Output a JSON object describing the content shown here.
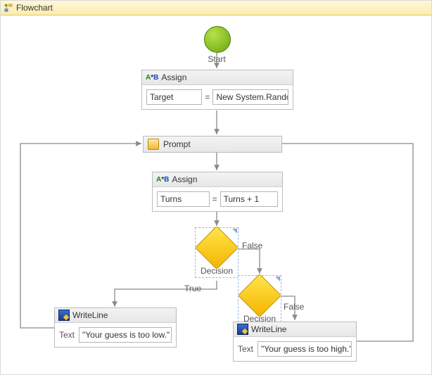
{
  "header": {
    "title": "Flowchart"
  },
  "start": {
    "label": "Start"
  },
  "assign1": {
    "title": "Assign",
    "left": "Target",
    "op": "=",
    "right": "New System.Rando"
  },
  "prompt": {
    "title": "Prompt"
  },
  "assign2": {
    "title": "Assign",
    "left": "Turns",
    "op": "=",
    "right": "Turns + 1"
  },
  "decision1": {
    "label": "Decision",
    "branch_true": "True",
    "branch_false": "False"
  },
  "decision2": {
    "label": "Decision",
    "branch_false": "False"
  },
  "writeline_low": {
    "title": "WriteLine",
    "prop": "Text",
    "value": "\"Your guess is too low.\""
  },
  "writeline_high": {
    "title": "WriteLine",
    "prop": "Text",
    "value": "\"Your guess is too high.\""
  }
}
